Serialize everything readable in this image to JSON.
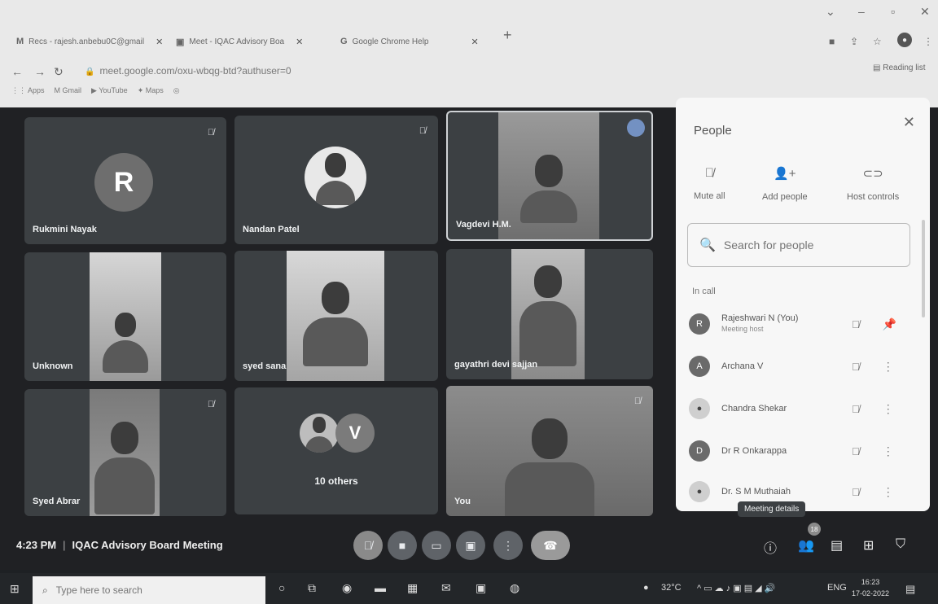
{
  "browser": {
    "tabs": [
      {
        "label": "Recs - rajesh.anbebu0C@gmail"
      },
      {
        "label": "Meet - IQAC Advisory Boa"
      },
      {
        "label": "Google Chrome Help"
      }
    ],
    "url": "meet.google.com/oxu-wbqg-btd?authuser=0",
    "bookmarks": [
      "Apps",
      "Gmail",
      "YouTube",
      "Maps"
    ],
    "reading_list": "Reading list"
  },
  "tiles": [
    {
      "name": "Rukmini Nayak",
      "initial": "R"
    },
    {
      "name": "Nandan Patel"
    },
    {
      "name": "Vagdevi H.M."
    },
    {
      "name": "Unknown"
    },
    {
      "name": "syed sana"
    },
    {
      "name": "gayathri devi sajjan"
    },
    {
      "name": "Syed Abrar"
    },
    {
      "name": "10 others",
      "initial": "V"
    },
    {
      "name": "You"
    }
  ],
  "people_panel": {
    "title": "People",
    "actions": [
      "Mute all",
      "Add people",
      "Host controls"
    ],
    "search_placeholder": "Search for people",
    "section": "In call",
    "participants": [
      {
        "name": "Rajeshwari N (You)",
        "sub": "Meeting host",
        "initial": "R"
      },
      {
        "name": "Archana V",
        "initial": "A"
      },
      {
        "name": "Chandra Shekar",
        "initial": ""
      },
      {
        "name": "Dr R Onkarappa",
        "initial": "D"
      },
      {
        "name": "Dr. S M Muthaiah",
        "initial": ""
      }
    ]
  },
  "tooltip": "Meeting details",
  "meeting": {
    "time": "4:23 PM",
    "title": "IQAC Advisory Board Meeting",
    "people_count": "18"
  },
  "taskbar": {
    "search_placeholder": "Type here to search",
    "weather": "32°C",
    "lang": "ENG",
    "time": "16:23",
    "date": "17-02-2022"
  }
}
